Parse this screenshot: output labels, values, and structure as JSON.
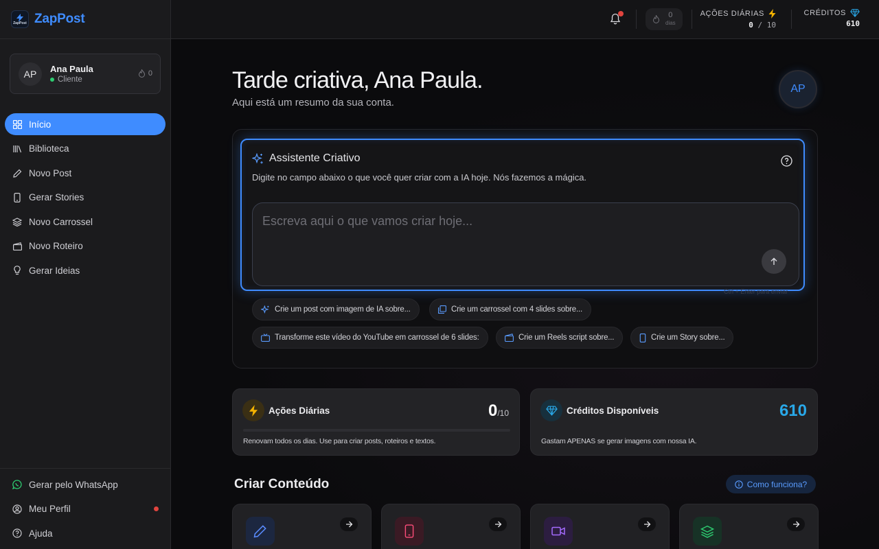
{
  "brand": {
    "name": "ZapPost",
    "logo_small_text": "ZapPost"
  },
  "user": {
    "initials": "AP",
    "name": "Ana Paula",
    "role": "Cliente",
    "streak": "0"
  },
  "nav": {
    "items": [
      {
        "label": "Início",
        "icon": "grid-icon",
        "active": true
      },
      {
        "label": "Biblioteca",
        "icon": "library-icon"
      },
      {
        "label": "Novo Post",
        "icon": "pencil-icon"
      },
      {
        "label": "Gerar Stories",
        "icon": "phone-icon"
      },
      {
        "label": "Novo Carrossel",
        "icon": "layers-icon"
      },
      {
        "label": "Novo Roteiro",
        "icon": "clapperboard-icon"
      },
      {
        "label": "Gerar Ideias",
        "icon": "lightbulb-icon"
      }
    ],
    "bottom": [
      {
        "label": "Gerar pelo WhatsApp",
        "icon": "whatsapp-icon"
      },
      {
        "label": "Meu Perfil",
        "icon": "user-circle-icon"
      },
      {
        "label": "Ajuda",
        "icon": "help-circle-icon"
      }
    ]
  },
  "topbar": {
    "streak": {
      "value": "0",
      "unit": "dias"
    },
    "daily_actions": {
      "label": "AÇÕES DIÁRIAS",
      "used": "0",
      "separator": "/",
      "total": "10"
    },
    "credits": {
      "label": "CRÉDITOS",
      "value": "610"
    }
  },
  "greeting": {
    "title": "Tarde criativa, Ana Paula.",
    "subtitle": "Aqui está um resumo da sua conta.",
    "avatar": "AP"
  },
  "assistant": {
    "title": "Assistente Criativo",
    "description": "Digite no campo abaixo o que você quer criar com a IA hoje. Nós fazemos a mágica.",
    "placeholder": "Escreva aqui o que vamos criar hoje...",
    "value": "",
    "hint": "Ctrl + Enter para enviar",
    "suggestions": [
      {
        "label": "Crie um post com imagem de IA sobre...",
        "icon": "sparkles-icon"
      },
      {
        "label": "Crie um carrossel com 4 slides sobre...",
        "icon": "gallery-icon"
      },
      {
        "label": "Transforme este vídeo do YouTube em carrossel de 6 slides:",
        "icon": "tv-icon"
      },
      {
        "label": "Crie um Reels script sobre...",
        "icon": "clapperboard-icon"
      },
      {
        "label": "Crie um Story sobre...",
        "icon": "phone-icon"
      }
    ]
  },
  "stats": {
    "daily": {
      "title": "Ações Diárias",
      "value": "0",
      "total": "/10",
      "progress": 0,
      "description": "Renovam todos os dias. Use para criar posts, roteiros e textos."
    },
    "credits": {
      "title": "Créditos Disponíveis",
      "value": "610",
      "description": "Gastam APENAS se gerar imagens com nossa IA."
    }
  },
  "create": {
    "title": "Criar Conteúdo",
    "how_label": "Como funciona?",
    "tiles": [
      {
        "icon": "pencil-icon",
        "color": "#5a8cff"
      },
      {
        "icon": "phone-icon",
        "color": "#ff4d7a"
      },
      {
        "icon": "video-icon",
        "color": "#a56bff"
      },
      {
        "icon": "layers-icon",
        "color": "#2ecc71"
      }
    ]
  },
  "colors": {
    "accent": "#3f8cff",
    "credits": "#29a8e8",
    "warning": "#f5b301",
    "danger": "#e0443e",
    "success": "#2ecc71"
  }
}
